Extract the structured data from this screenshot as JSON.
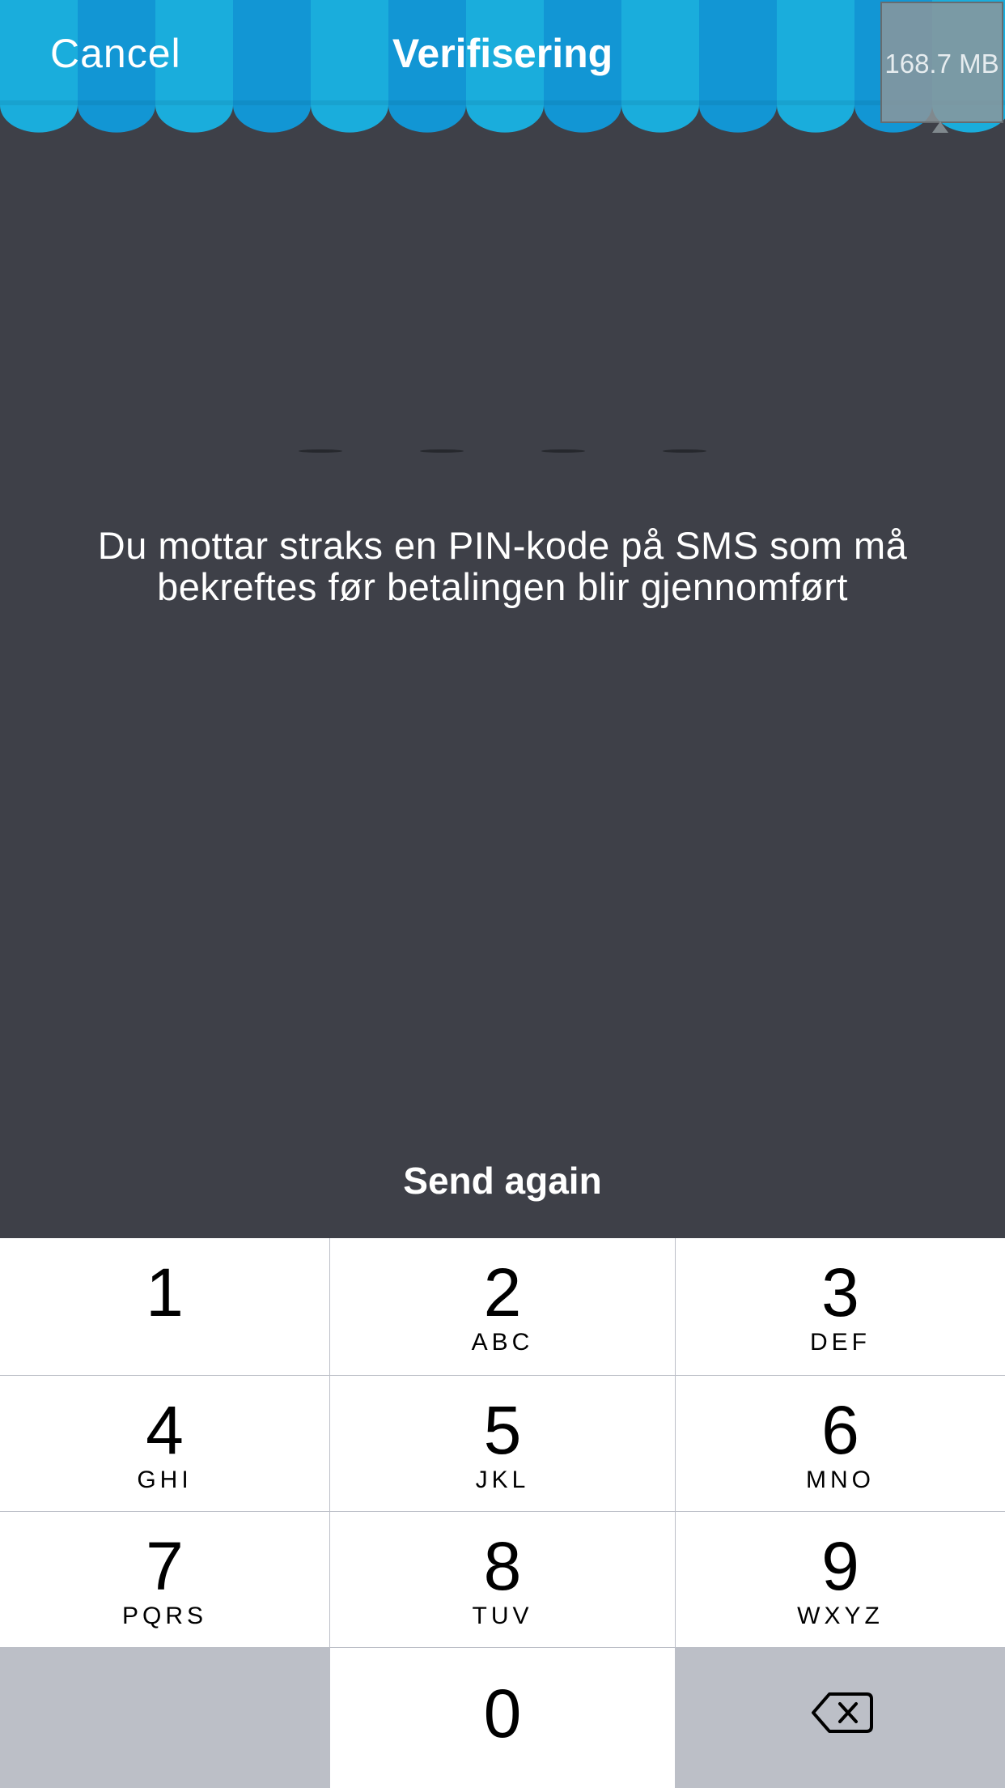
{
  "nav": {
    "cancel_label": "Cancel",
    "title": "Verifisering",
    "memory_badge": "168.7 MB"
  },
  "pin": {
    "length": 4,
    "message": "Du mottar straks en PIN-kode på SMS som må bekreftes før betalingen blir gjennomført"
  },
  "send_again_label": "Send again",
  "keypad": {
    "keys": [
      {
        "num": "1",
        "letters": ""
      },
      {
        "num": "2",
        "letters": "ABC"
      },
      {
        "num": "3",
        "letters": "DEF"
      },
      {
        "num": "4",
        "letters": "GHI"
      },
      {
        "num": "5",
        "letters": "JKL"
      },
      {
        "num": "6",
        "letters": "MNO"
      },
      {
        "num": "7",
        "letters": "PQRS"
      },
      {
        "num": "8",
        "letters": "TUV"
      },
      {
        "num": "9",
        "letters": "WXYZ"
      }
    ],
    "zero": "0",
    "backspace_icon": "backspace-icon"
  },
  "colors": {
    "awning_light": "#1aaddc",
    "awning_dark": "#1296d4",
    "background": "#3e4048",
    "keypad_gray": "#bcbfc7"
  }
}
